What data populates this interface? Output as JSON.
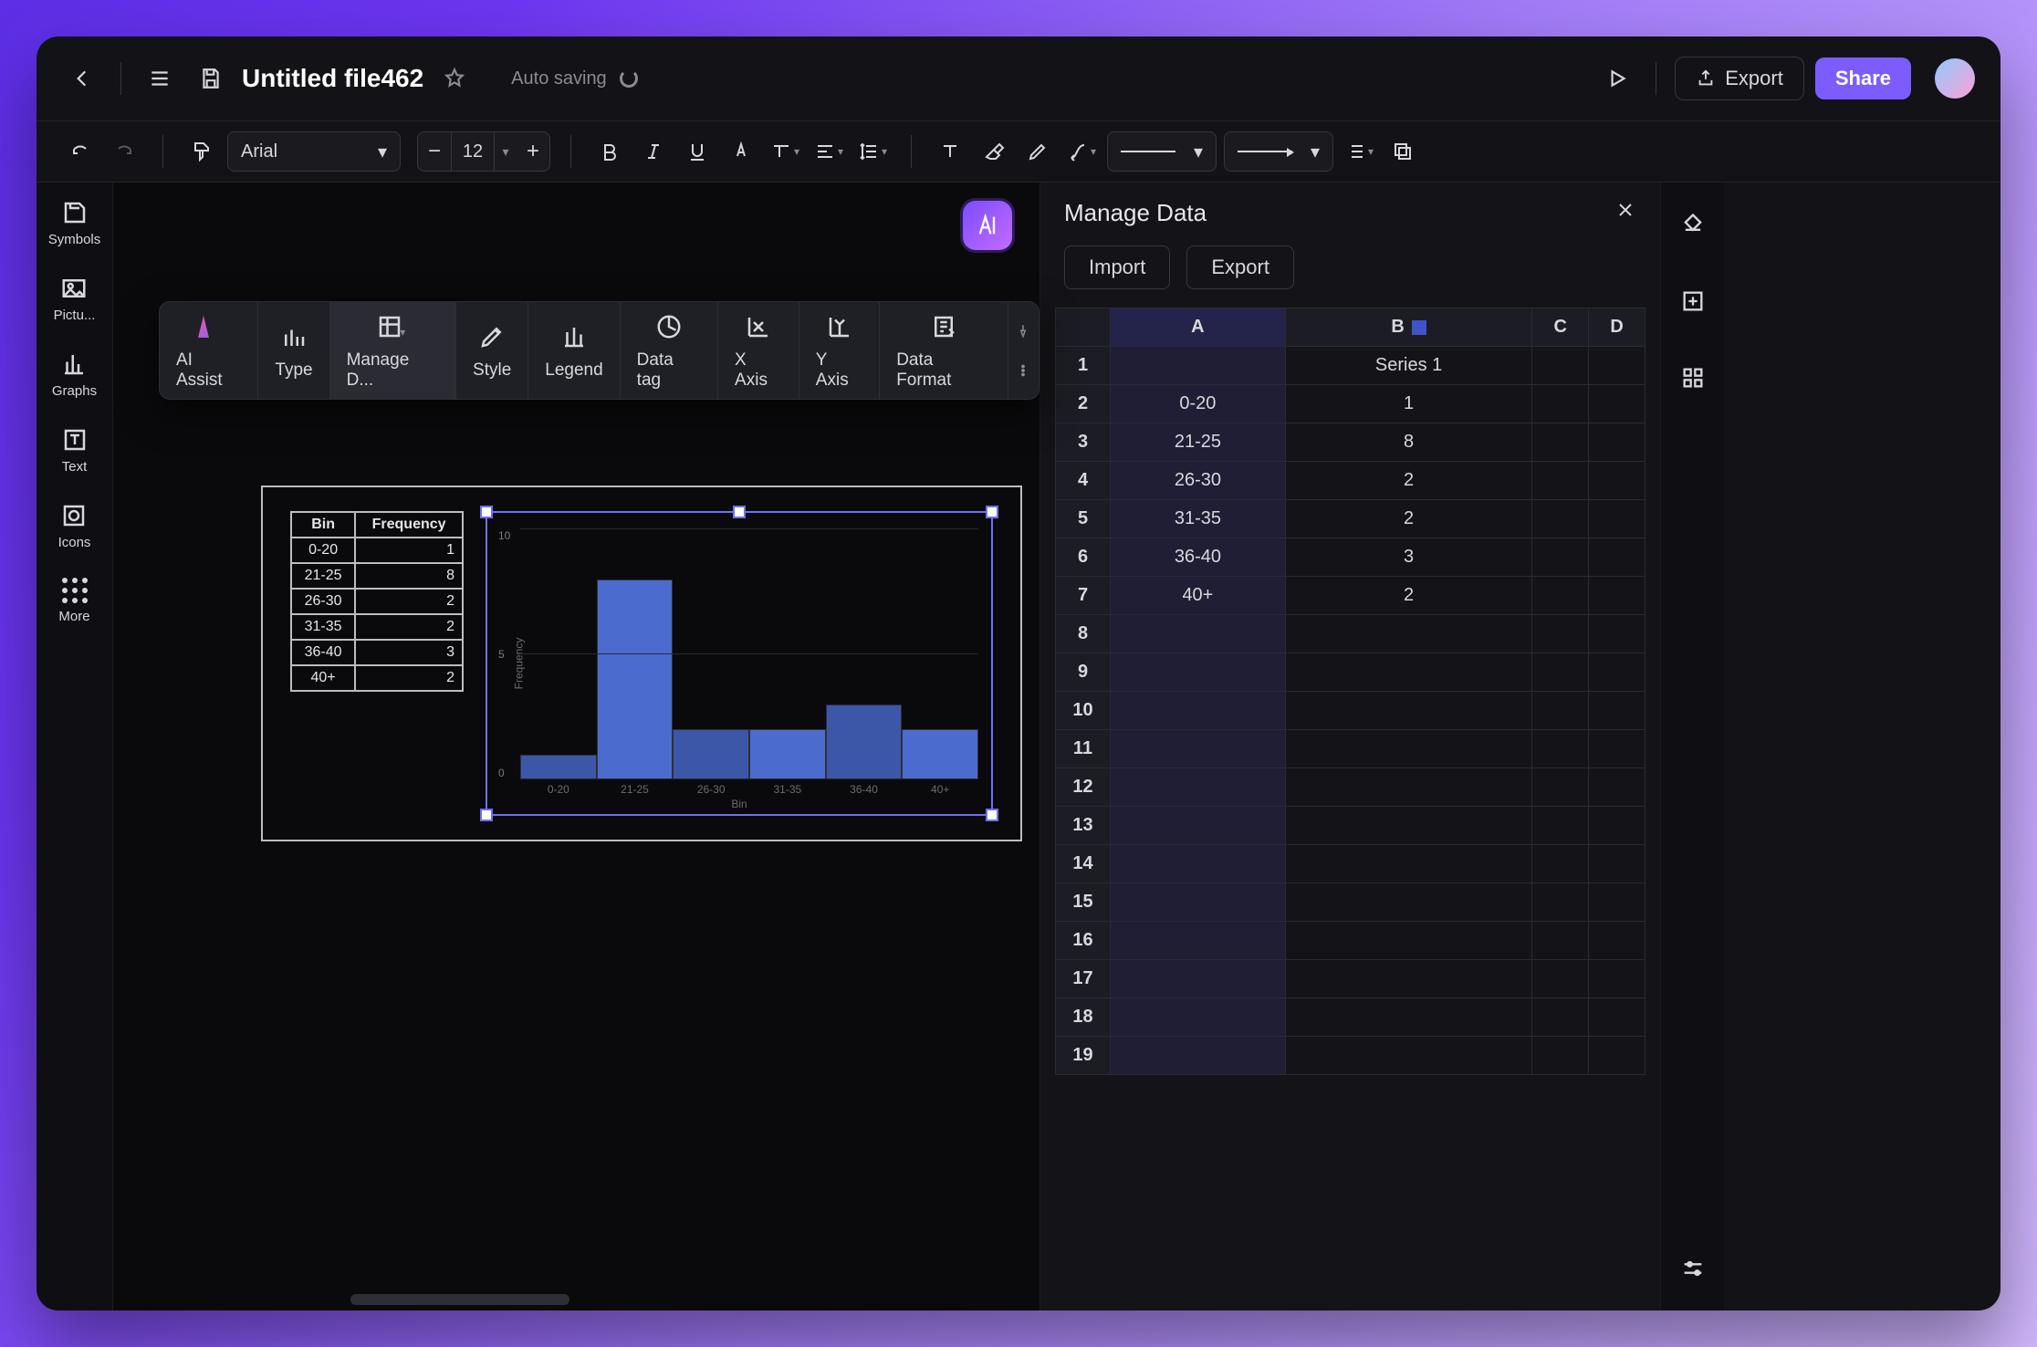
{
  "header": {
    "file_title": "Untitled file462",
    "autosave": "Auto saving",
    "export": "Export",
    "share": "Share"
  },
  "toolbar": {
    "font": "Arial",
    "font_size": "12"
  },
  "left_rail": {
    "symbols": "Symbols",
    "pictures": "Pictu...",
    "graphs": "Graphs",
    "text": "Text",
    "icons": "Icons",
    "more": "More"
  },
  "chart_toolbar": {
    "ai_assist": "AI Assist",
    "type": "Type",
    "manage_data": "Manage D...",
    "style": "Style",
    "legend": "Legend",
    "data_tag": "Data tag",
    "x_axis": "X Axis",
    "y_axis": "Y Axis",
    "data_format": "Data Format"
  },
  "bin_table": {
    "col_bin": "Bin",
    "col_freq": "Frequency",
    "rows": [
      {
        "bin": "0-20",
        "freq": "1"
      },
      {
        "bin": "21-25",
        "freq": "8"
      },
      {
        "bin": "26-30",
        "freq": "2"
      },
      {
        "bin": "31-35",
        "freq": "2"
      },
      {
        "bin": "36-40",
        "freq": "3"
      },
      {
        "bin": "40+",
        "freq": "2"
      }
    ]
  },
  "manage_panel": {
    "title": "Manage Data",
    "import": "Import",
    "export": "Export",
    "columns": [
      "A",
      "B",
      "C",
      "D"
    ],
    "series_header": "Series 1",
    "rows": [
      {
        "n": "1",
        "a": "",
        "b": "Series 1"
      },
      {
        "n": "2",
        "a": "0-20",
        "b": "1"
      },
      {
        "n": "3",
        "a": "21-25",
        "b": "8"
      },
      {
        "n": "4",
        "a": "26-30",
        "b": "2"
      },
      {
        "n": "5",
        "a": "31-35",
        "b": "2"
      },
      {
        "n": "6",
        "a": "36-40",
        "b": "3"
      },
      {
        "n": "7",
        "a": "40+",
        "b": "2"
      },
      {
        "n": "8",
        "a": "",
        "b": ""
      },
      {
        "n": "9",
        "a": "",
        "b": ""
      },
      {
        "n": "10",
        "a": "",
        "b": ""
      },
      {
        "n": "11",
        "a": "",
        "b": ""
      },
      {
        "n": "12",
        "a": "",
        "b": ""
      },
      {
        "n": "13",
        "a": "",
        "b": ""
      },
      {
        "n": "14",
        "a": "",
        "b": ""
      },
      {
        "n": "15",
        "a": "",
        "b": ""
      },
      {
        "n": "16",
        "a": "",
        "b": ""
      },
      {
        "n": "17",
        "a": "",
        "b": ""
      },
      {
        "n": "18",
        "a": "",
        "b": ""
      },
      {
        "n": "19",
        "a": "",
        "b": ""
      }
    ]
  },
  "chart_data": {
    "type": "bar",
    "title": "",
    "xlabel": "Bin",
    "ylabel": "Frequency",
    "categories": [
      "0-20",
      "21-25",
      "26-30",
      "31-35",
      "36-40",
      "40+"
    ],
    "series": [
      {
        "name": "Series 1",
        "values": [
          1,
          8,
          2,
          2,
          3,
          2
        ]
      }
    ],
    "ylim": [
      0,
      10
    ],
    "y_ticks": [
      10,
      5,
      0
    ]
  }
}
